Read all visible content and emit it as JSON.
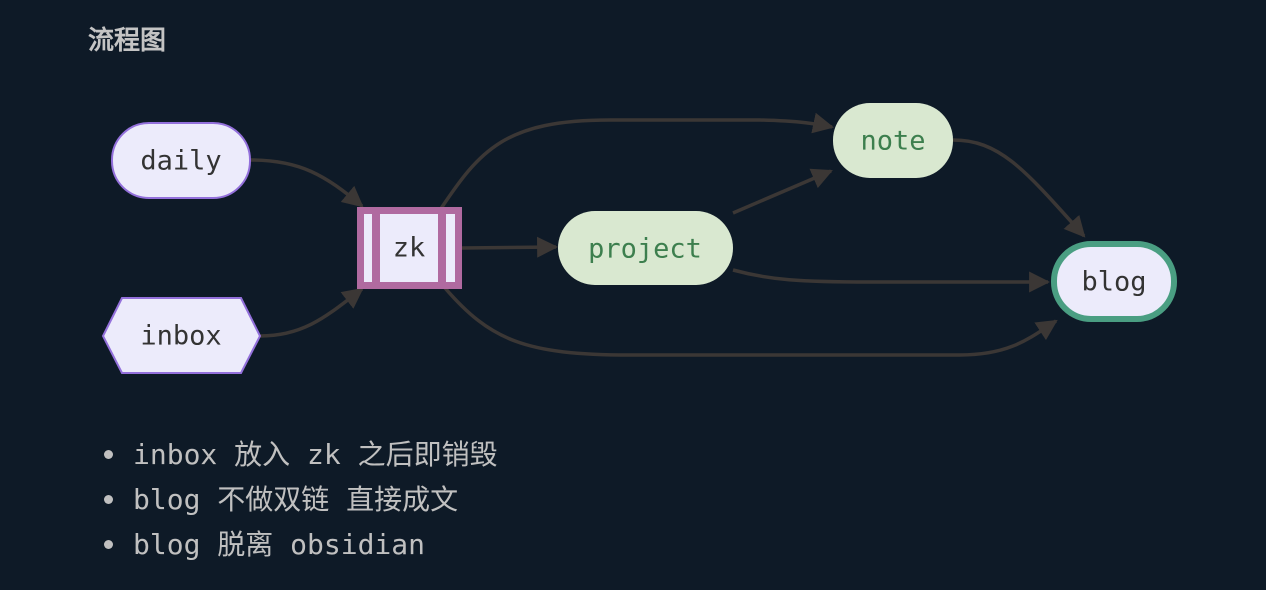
{
  "title": "流程图",
  "nodes": {
    "daily": "daily",
    "inbox": "inbox",
    "zk": "zk",
    "project": "project",
    "note": "note",
    "blog": "blog"
  },
  "edges": [
    [
      "daily",
      "zk"
    ],
    [
      "inbox",
      "zk"
    ],
    [
      "zk",
      "note"
    ],
    [
      "zk",
      "project"
    ],
    [
      "zk",
      "blog"
    ],
    [
      "project",
      "note"
    ],
    [
      "project",
      "blog"
    ],
    [
      "note",
      "blog"
    ]
  ],
  "colors": {
    "background": "#0e1a27",
    "default_fill": "#ecebfb",
    "default_stroke": "#9370db",
    "green_fill": "#d9e8d0",
    "green_text": "#3d7f4e",
    "zk_stroke": "#b06aa0",
    "blog_stroke": "#4a9e82",
    "edge": "#3b3735"
  },
  "notes": [
    "inbox 放入 zk 之后即销毁",
    "blog 不做双链 直接成文",
    "blog 脱离 obsidian"
  ]
}
